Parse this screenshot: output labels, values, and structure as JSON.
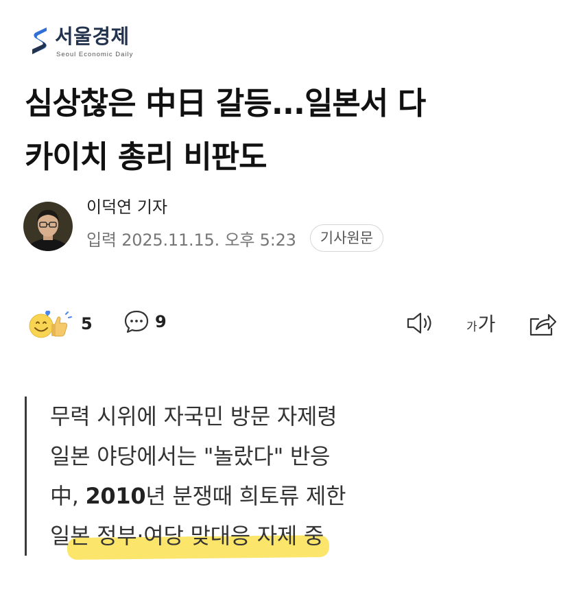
{
  "brand": {
    "name_ko": "서울경제",
    "name_en": "Seoul Economic Daily",
    "color": "#23324d",
    "accent": "#2f6fd6"
  },
  "article": {
    "title_line1": "심상찮은 中日 갈등...일본서 다",
    "title_line2": "카이치 총리 비판도",
    "reporter": "이덕연 기자",
    "published": "입력 2025.11.15. 오후 5:23",
    "source_button": "기사원문"
  },
  "toolbar": {
    "reaction_icon": "smile-thumbs-up-reaction-icon",
    "reaction_count": "5",
    "comment_icon": "speech-bubble-icon",
    "comment_count": "9",
    "audio_icon": "speaker-icon",
    "font_small": "가",
    "font_large": "가",
    "share_icon": "share-icon"
  },
  "summary": {
    "line1": "무력 시위에 자국민 방문 자제령",
    "line2": "일본 야당에서는 \"놀랐다\" 반응",
    "line3_prefix": "中, ",
    "line3_bold": "2010",
    "line3_suffix": "년 분쟁때 희토류 제한",
    "line4_start": "일",
    "line4_highlighted": "본 정부·여당 맞대응 자제 중",
    "highlight_color": "#fbe56a"
  }
}
